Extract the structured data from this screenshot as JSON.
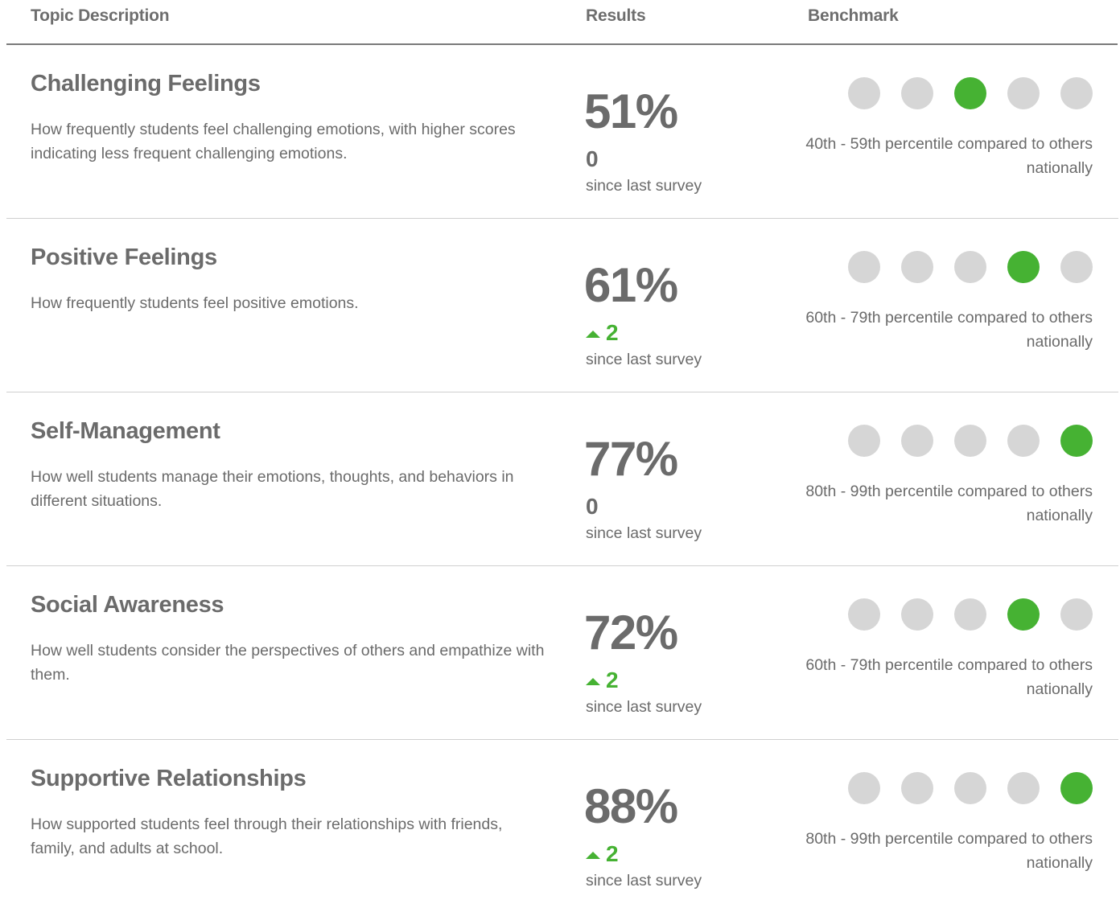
{
  "header": {
    "topic_description": "Topic Description",
    "results": "Results",
    "benchmark": "Benchmark"
  },
  "colors": {
    "active_dot": "#46b233",
    "inactive_dot": "#d6d6d6",
    "text": "#6b6b6b",
    "positive_change": "#46b233"
  },
  "rows": [
    {
      "title": "Challenging Feelings",
      "description": "How frequently students feel challenging emotions, with higher scores indicating less frequent challenging emotions.",
      "result": "51%",
      "change": "0",
      "change_direction": "none",
      "since_label": "since last survey",
      "benchmark_level": 3,
      "benchmark_text": "40th - 59th percentile compared to others nationally"
    },
    {
      "title": "Positive Feelings",
      "description": "How frequently students feel positive emotions.",
      "result": "61%",
      "change": "2",
      "change_direction": "up",
      "since_label": "since last survey",
      "benchmark_level": 4,
      "benchmark_text": "60th - 79th percentile compared to others nationally"
    },
    {
      "title": "Self-Management",
      "description": "How well students manage their emotions, thoughts, and behaviors in different situations.",
      "result": "77%",
      "change": "0",
      "change_direction": "none",
      "since_label": "since last survey",
      "benchmark_level": 5,
      "benchmark_text": "80th - 99th percentile compared to others nationally"
    },
    {
      "title": "Social Awareness",
      "description": "How well students consider the perspectives of others and empathize with them.",
      "result": "72%",
      "change": "2",
      "change_direction": "up",
      "since_label": "since last survey",
      "benchmark_level": 4,
      "benchmark_text": "60th - 79th percentile compared to others nationally"
    },
    {
      "title": "Supportive Relationships",
      "description": "How supported students feel through their relationships with friends, family, and adults at school.",
      "result": "88%",
      "change": "2",
      "change_direction": "up",
      "since_label": "since last survey",
      "benchmark_level": 5,
      "benchmark_text": "80th - 99th percentile compared to others nationally"
    }
  ]
}
